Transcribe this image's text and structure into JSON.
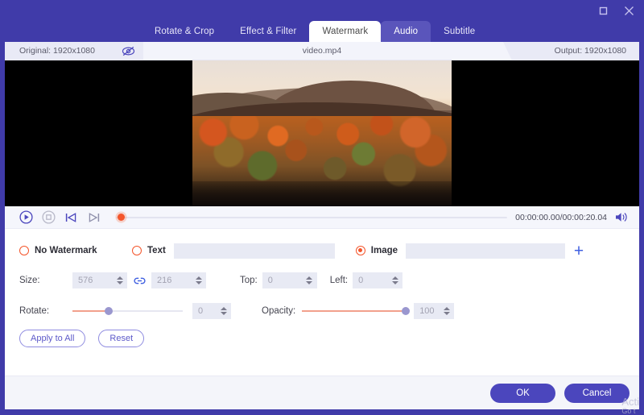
{
  "window": {
    "app_accent": "#403ba9",
    "controls": [
      {
        "name": "maximize",
        "icon": "maximize-icon"
      },
      {
        "name": "close",
        "icon": "close-icon"
      }
    ]
  },
  "tabs": [
    {
      "label": "Rotate & Crop",
      "state": "normal"
    },
    {
      "label": "Effect & Filter",
      "state": "normal"
    },
    {
      "label": "Watermark",
      "state": "active"
    },
    {
      "label": "Audio",
      "state": "hover"
    },
    {
      "label": "Subtitle",
      "state": "normal"
    }
  ],
  "infostrip": {
    "original_label": "Original: 1920x1080",
    "output_label": "Output: 1920x1080",
    "filename": "video.mp4",
    "preview_toggle_icon": "eye-off-icon"
  },
  "transport": {
    "play_icon": "play-circle-icon",
    "stop_icon": "stop-circle-icon",
    "prev_icon": "previous-frame-icon",
    "next_icon": "next-frame-icon",
    "volume_icon": "volume-icon",
    "current_time": "00:00:00.00",
    "total_time": "00:00:20.04",
    "timecode": "00:00:00.00/00:00:20.04",
    "playhead_percent": 0,
    "playhead_color": "#f4552b"
  },
  "watermark": {
    "options": [
      {
        "id": "no-watermark",
        "label": "No Watermark",
        "selected": false
      },
      {
        "id": "text",
        "label": "Text",
        "selected": false
      },
      {
        "id": "image",
        "label": "Image",
        "selected": true
      }
    ],
    "text_value": "",
    "text_placeholder": "",
    "image_value": "",
    "image_placeholder": "",
    "add_image_label": "+",
    "radio_color": "#f4552b"
  },
  "fields": {
    "size_label": "Size:",
    "size_width": "576",
    "size_height": "216",
    "link_icon": "link-icon",
    "top_label": "Top:",
    "top_value": "0",
    "left_label": "Left:",
    "left_value": "0",
    "rotate_label": "Rotate:",
    "rotate_value": "0",
    "rotate_percent": 33,
    "opacity_label": "Opacity:",
    "opacity_value": "100",
    "opacity_percent": 100
  },
  "actions": {
    "apply_to_all": "Apply to All",
    "reset": "Reset"
  },
  "footer": {
    "ok": "OK",
    "cancel": "Cancel",
    "button_color": "#4b46bd"
  },
  "overlay": {
    "activate_line1": "Acti",
    "activate_line2": "Go t"
  }
}
